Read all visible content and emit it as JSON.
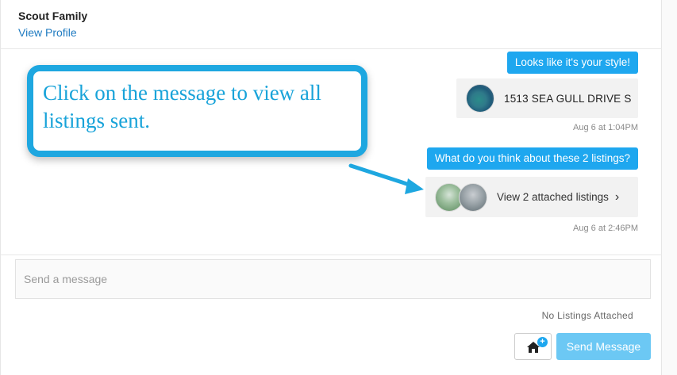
{
  "header": {
    "contact_name": "Scout Family",
    "view_profile": "View Profile"
  },
  "messages": [
    {
      "text": "Looks like it's your style!",
      "listing_label": "1513 SEA GULL DRIVE S",
      "timestamp": "Aug 6 at 1:04PM"
    },
    {
      "text": "What do you think about these 2 listings?",
      "listing_label": "View 2 attached listings",
      "timestamp": "Aug 6 at 2:46PM"
    }
  ],
  "composer": {
    "placeholder": "Send a message",
    "attachments_status": "No Listings Attached",
    "send_label": "Send Message",
    "attach_icon": "home-plus-icon"
  },
  "annotation": {
    "callout_text": "Click on the message to view all listings sent."
  },
  "colors": {
    "accent": "#1ea7ef",
    "link": "#1f7bc1",
    "send_button": "#6cc8f4",
    "callout": "#1ea7e0"
  }
}
